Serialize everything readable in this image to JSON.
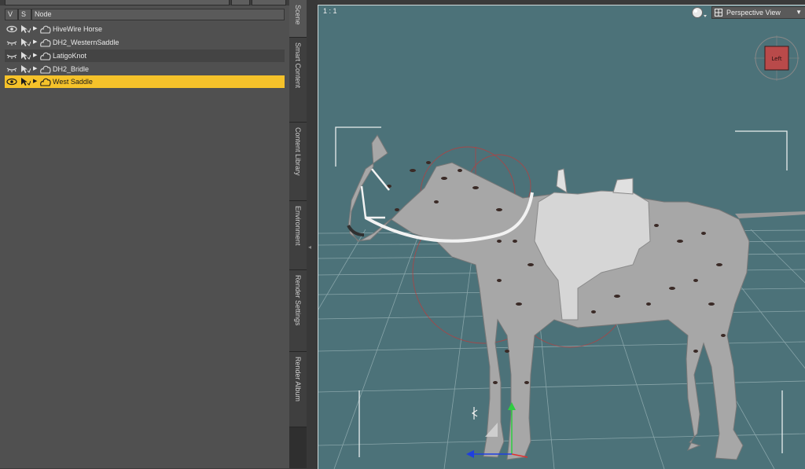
{
  "scene": {
    "columns": {
      "v": "V",
      "s": "S",
      "node": "Node"
    },
    "nodes": [
      {
        "label": "HiveWire Horse",
        "visible": true,
        "selected": false
      },
      {
        "label": "DH2_WesternSaddle",
        "visible": false,
        "selected": false
      },
      {
        "label": "LatigoKnot",
        "visible": false,
        "selected": false
      },
      {
        "label": "DH2_Bridle",
        "visible": false,
        "selected": false
      },
      {
        "label": "West Saddle",
        "visible": true,
        "selected": true
      }
    ]
  },
  "side_tabs": [
    "Scene",
    "Smart Content",
    "Content Library",
    "Environment",
    "Render Settings",
    "Render Album"
  ],
  "viewport": {
    "aspect_label": "1 : 1",
    "view_menu_label": "Perspective View",
    "view_cube_label": "Left"
  },
  "colors": {
    "selection_accent": "#f5c22a",
    "viewport_background": "#4c7279",
    "panel_background": "#505050"
  },
  "icons": [
    "eye-icon",
    "closed-eye-icon",
    "cursor-select-icon",
    "expand-arrow-icon",
    "figure-node-icon",
    "render-sphere-icon",
    "camera-view-icon",
    "dropdown-arrow-icon",
    "view-cube-icon",
    "transform-gizmo-icon"
  ]
}
